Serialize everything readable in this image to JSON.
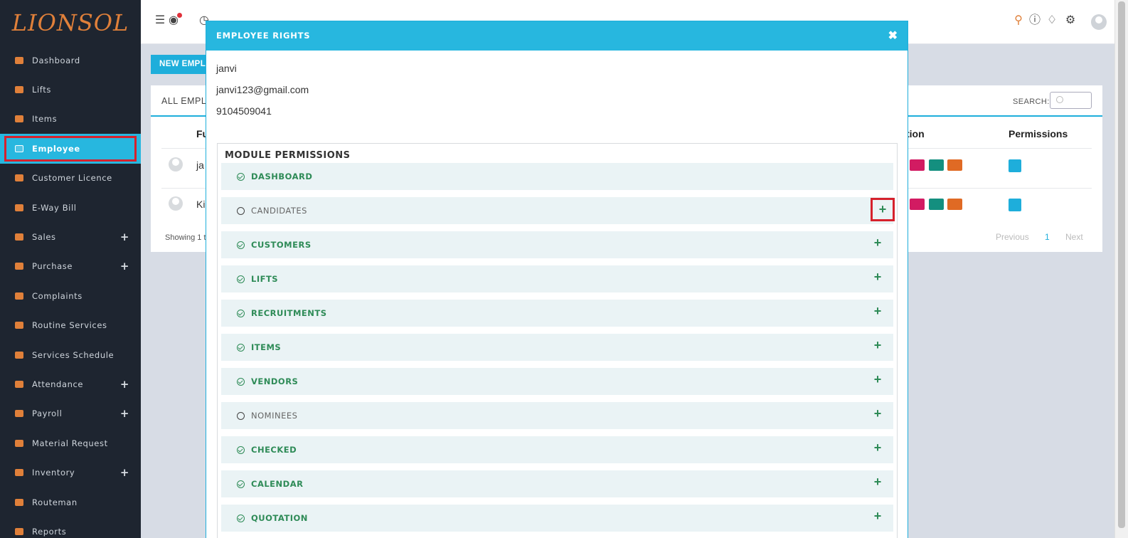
{
  "brand": {
    "logo_text": "LIONSOL"
  },
  "sidebar": {
    "items": [
      {
        "label": "Dashboard",
        "icon": "dashboard-icon",
        "plus": ""
      },
      {
        "label": "Lifts",
        "icon": "gear-icon",
        "plus": ""
      },
      {
        "label": "Items",
        "icon": "archive-icon",
        "plus": ""
      },
      {
        "label": "Employee",
        "icon": "user-icon",
        "plus": "",
        "active": true
      },
      {
        "label": "Customer Licence",
        "icon": "upload-icon",
        "plus": ""
      },
      {
        "label": "E-Way Bill",
        "icon": "truck-icon",
        "plus": ""
      },
      {
        "label": "Sales",
        "icon": "cart-icon",
        "plus": "+"
      },
      {
        "label": "Purchase",
        "icon": "briefcase-icon",
        "plus": "+"
      },
      {
        "label": "Complaints",
        "icon": "tag-icon",
        "plus": ""
      },
      {
        "label": "Routine Services",
        "icon": "cogs-icon",
        "plus": ""
      },
      {
        "label": "Services Schedule",
        "icon": "grid-icon",
        "plus": ""
      },
      {
        "label": "Attendance",
        "icon": "archive-icon",
        "plus": "+"
      },
      {
        "label": "Payroll",
        "icon": "archive-icon",
        "plus": "+"
      },
      {
        "label": "Material Request",
        "icon": "grid-icon",
        "plus": ""
      },
      {
        "label": "Inventory",
        "icon": "archive-icon",
        "plus": "+"
      },
      {
        "label": "Routeman",
        "icon": "users-icon",
        "plus": ""
      },
      {
        "label": "Reports",
        "icon": "chart-icon",
        "plus": ""
      }
    ]
  },
  "topbar": {
    "icons": [
      "hamburger-icon",
      "globe-icon",
      "clock-icon",
      "search-icon",
      "help-icon",
      "bell-icon",
      "gear-icon",
      "avatar"
    ]
  },
  "background": {
    "new_employee_button": "NEW EMPL",
    "panel_title": "ALL EMPL",
    "search_label": "SEARCH:",
    "col_name": "Fu",
    "col_action": "tion",
    "col_permissions": "Permissions",
    "rows": [
      {
        "name": "ja"
      },
      {
        "name": "Ki"
      }
    ],
    "showing": "Showing 1 t",
    "pagination": {
      "previous": "Previous",
      "current": "1",
      "next": "Next"
    }
  },
  "modal": {
    "title": "EMPLOYEE RIGHTS",
    "close": "✖",
    "employee": {
      "name": "janvi",
      "email": "janvi123@gmail.com",
      "phone": "9104509041"
    },
    "permissions_title": "MODULE PERMISSIONS",
    "modules": [
      {
        "label": "DASHBOARD",
        "checked": true,
        "expand": ""
      },
      {
        "label": "CANDIDATES",
        "checked": false,
        "expand": "+",
        "highlight": true
      },
      {
        "label": "CUSTOMERS",
        "checked": true,
        "expand": "+"
      },
      {
        "label": "LIFTS",
        "checked": true,
        "expand": "+"
      },
      {
        "label": "RECRUITMENTS",
        "checked": true,
        "expand": "+"
      },
      {
        "label": "ITEMS",
        "checked": true,
        "expand": "+"
      },
      {
        "label": "VENDORS",
        "checked": true,
        "expand": "+"
      },
      {
        "label": "NOMINEES",
        "checked": false,
        "expand": "+"
      },
      {
        "label": "CHECKED",
        "checked": true,
        "expand": "+"
      },
      {
        "label": "CALENDAR",
        "checked": true,
        "expand": "+"
      },
      {
        "label": "QUOTATION",
        "checked": true,
        "expand": "+"
      }
    ]
  },
  "colors": {
    "accent": "#27b7df",
    "sidebar_bg": "#1e2530",
    "icon_orange": "#e0803a",
    "check_green": "#2e8b57",
    "highlight_red": "#d6212c"
  }
}
